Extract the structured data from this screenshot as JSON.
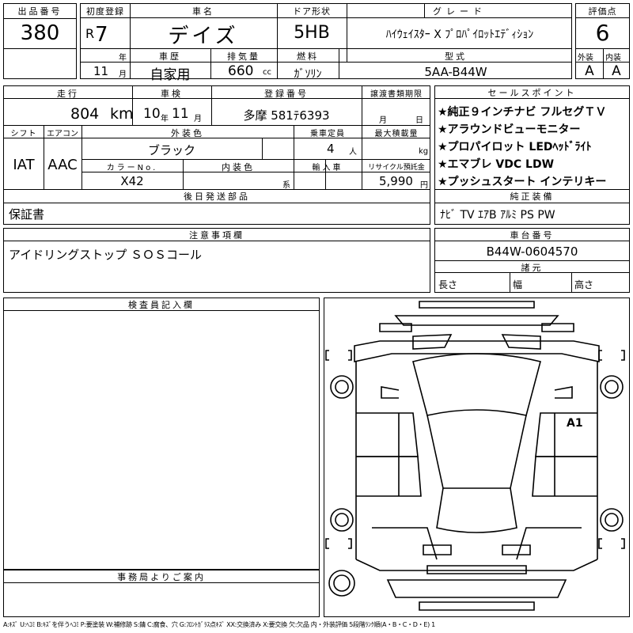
{
  "lot": {
    "label": "出品番号",
    "value": "380"
  },
  "first_reg": {
    "label": "初度登録",
    "era": "R",
    "year": "7",
    "year_unit": "年",
    "month": "11",
    "month_unit": "月"
  },
  "car_name": {
    "label": "車名",
    "value": "デイズ"
  },
  "doors": {
    "label": "ドア形状",
    "value": "5HB"
  },
  "grade": {
    "label": "グレード",
    "value": "ﾊｲｳｪｲｽﾀｰ X ﾌﾟﾛﾊﾟｲﾛｯﾄｴﾃﾞｨｼｮﾝ"
  },
  "score": {
    "label": "評価点",
    "value": "6",
    "exterior_label": "外装",
    "interior_label": "内装",
    "exterior": "A",
    "interior": "A"
  },
  "history": {
    "label": "車歴",
    "value": "自家用"
  },
  "displacement": {
    "label": "排気量",
    "value": "660",
    "unit": "cc"
  },
  "fuel": {
    "label": "燃料",
    "value": "ｶﾞｿﾘﾝ"
  },
  "model": {
    "label": "型式",
    "value": "5AA-B44W"
  },
  "mileage": {
    "label": "走行",
    "value": "804",
    "unit": "km"
  },
  "inspection": {
    "label": "車検",
    "year": "10",
    "year_unit": "年",
    "month": "11",
    "month_unit": "月"
  },
  "reg_number": {
    "label": "登録番号",
    "value": "多摩 581ﾃ6393"
  },
  "transfer_deadline": {
    "label": "譲渡書類期限",
    "month_unit": "月",
    "day_unit": "日"
  },
  "shift": {
    "label": "シフト",
    "value": "IAT"
  },
  "aircon": {
    "label": "エアコン",
    "value": "AAC"
  },
  "ext_color": {
    "label": "外装色",
    "value": "ブラック"
  },
  "capacity": {
    "label": "乗車定員",
    "value": "4",
    "unit": "人"
  },
  "max_load": {
    "label": "最大積載量",
    "unit": "kg"
  },
  "color_no": {
    "label": "カラーNo.",
    "value": "X42"
  },
  "int_color": {
    "label": "内装色",
    "unit": "系"
  },
  "import": {
    "label": "輸入車"
  },
  "recycle": {
    "label": "リサイクル預託金",
    "value": "5,990",
    "unit": "円"
  },
  "later_parts": {
    "label": "後日発送部品",
    "value": "保証書"
  },
  "sales_points": {
    "label": "セールスポイント",
    "items": [
      "★純正９インチナビ フルセグＴＶ",
      "★アラウンドビューモニター",
      "★プロパイロット LEDﾍｯﾄﾞﾗｲﾄ",
      "★エマブレ VDC LDW",
      "★プッシュスタート インテリキー"
    ]
  },
  "equipment": {
    "label": "純正装備",
    "value": "ﾅﾋﾞ TV ｴｱB ｱﾙﾐ PS PW"
  },
  "notes": {
    "label": "注意事項欄",
    "value": "アイドリングストップ ＳＯＳコール"
  },
  "chassis": {
    "label": "車台番号",
    "value": "B44W-0604570"
  },
  "specs": {
    "label": "諸元",
    "length": "長さ",
    "width": "幅",
    "height": "高さ"
  },
  "inspector": {
    "label": "検査員記入欄"
  },
  "office": {
    "label": "事務局よりご案内"
  },
  "diagram": {
    "mark": "A1"
  },
  "legend": "A:ｷｽﾞ U:ﾍｺﾐ B:ｷｽﾞを伴うﾍｺﾐ P:要塗装 W:補修跡 S:錆 C:腐食、穴 G:ﾌﾛﾝﾄｶﾞﾗｽ点ｷｽﾞ XX:交換済み X:要交換 欠:欠品 内・外装評価 5段階ﾗﾝｸ順(A・B・C・D・E) 1"
}
